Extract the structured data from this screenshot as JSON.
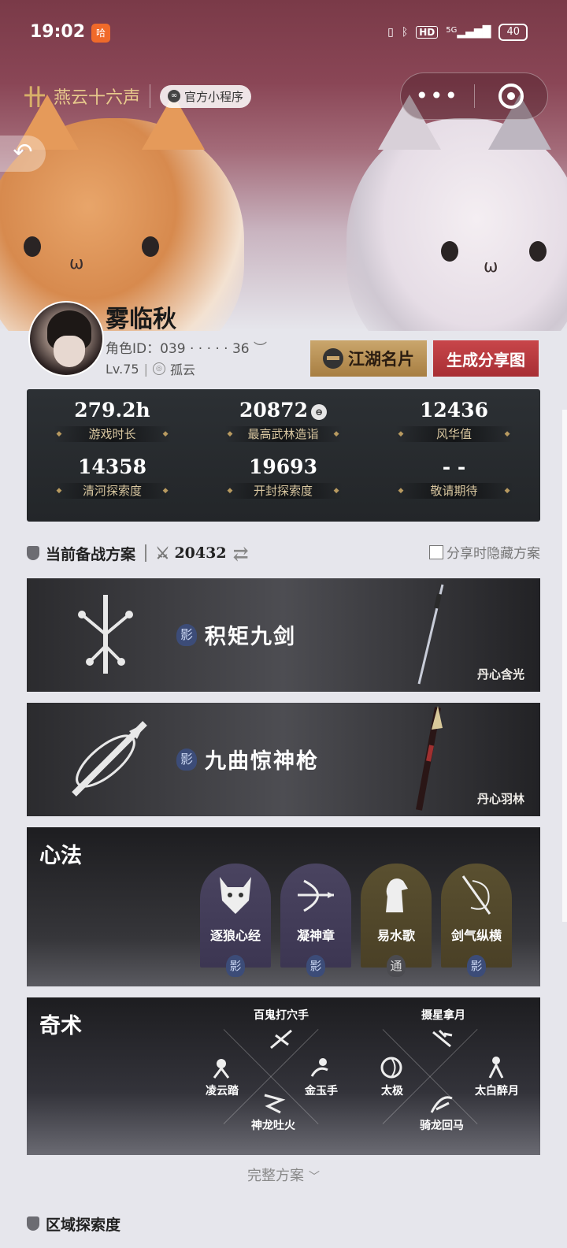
{
  "status_bar": {
    "time": "19:02",
    "app_badge": "哈",
    "network": "5G",
    "hd": "HD",
    "battery": "40"
  },
  "header": {
    "logo": "燕云十六声",
    "logo_mark": "卄",
    "official_label": "官方小程序",
    "capsule_more": "•••"
  },
  "profile": {
    "name": "雾临秋",
    "role_id": "角色ID：039 · · · · · 36",
    "level": "Lv.75",
    "server": "孤云",
    "card_button": "江湖名片",
    "share_button": "生成分享图"
  },
  "stats": [
    {
      "value": "279.2h",
      "label": "游戏时长"
    },
    {
      "value": "20872",
      "label": "最高武林造诣"
    },
    {
      "value": "12436",
      "label": "风华值"
    },
    {
      "value": "14358",
      "label": "清河探索度"
    },
    {
      "value": "19693",
      "label": "开封探索度"
    },
    {
      "value": "- -",
      "label": "敬请期待"
    }
  ],
  "loadout": {
    "title": "当前备战方案",
    "power": "20432",
    "hide_label": "分享时隐藏方案"
  },
  "weapons": [
    {
      "name": "积矩九剑",
      "tag": "影",
      "subtitle": "丹心含光"
    },
    {
      "name": "九曲惊神枪",
      "tag": "影",
      "subtitle": "丹心羽林"
    }
  ],
  "mental": {
    "title": "心法",
    "skills": [
      {
        "name": "逐狼心经",
        "tag": "影",
        "style": "purple"
      },
      {
        "name": "凝神章",
        "tag": "影",
        "style": "purple"
      },
      {
        "name": "易水歌",
        "tag": "通",
        "style": "gold"
      },
      {
        "name": "剑气纵横",
        "tag": "影",
        "style": "gold"
      }
    ]
  },
  "techniques": {
    "title": "奇术",
    "items": [
      "百鬼打穴手",
      "凌云踏",
      "金玉手",
      "神龙吐火",
      "摄星拿月",
      "太极",
      "太白醉月",
      "骑龙回马"
    ]
  },
  "full_plan": "完整方案",
  "region_title": "区域探索度"
}
